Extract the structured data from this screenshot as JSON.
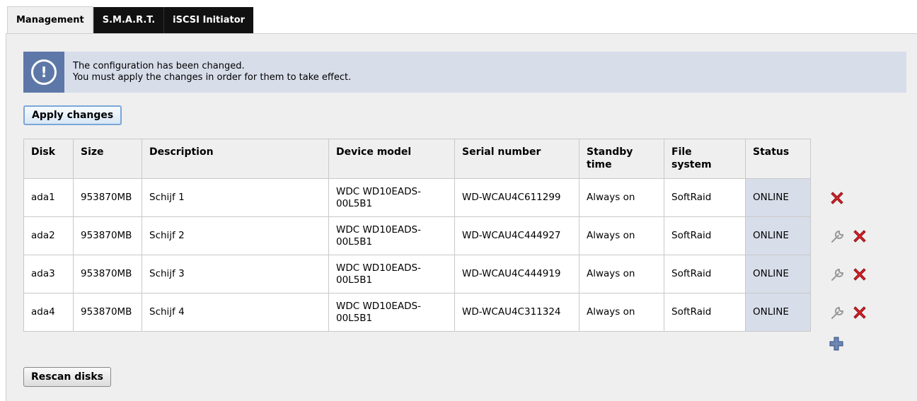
{
  "tabs": [
    {
      "label": "Management",
      "active": true
    },
    {
      "label": "S.M.A.R.T.",
      "active": false
    },
    {
      "label": "iSCSI Initiator",
      "active": false
    }
  ],
  "notice": {
    "line1": "The configuration has been changed.",
    "line2": "You must apply the changes in order for them to take effect."
  },
  "buttons": {
    "apply": "Apply changes",
    "rescan": "Rescan disks"
  },
  "table": {
    "headers": [
      "Disk",
      "Size",
      "Description",
      "Device model",
      "Serial number",
      "Standby time",
      "File system",
      "Status"
    ],
    "rows": [
      {
        "disk": "ada1",
        "size": "953870MB",
        "description": "Schijf 1",
        "model": "WDC WD10EADS-00L5B1",
        "serial": "WD-WCAU4C611299",
        "standby": "Always on",
        "fs": "SoftRaid",
        "status": "ONLINE"
      },
      {
        "disk": "ada2",
        "size": "953870MB",
        "description": "Schijf 2",
        "model": "WDC WD10EADS-00L5B1",
        "serial": "WD-WCAU4C444927",
        "standby": "Always on",
        "fs": "SoftRaid",
        "status": "ONLINE"
      },
      {
        "disk": "ada3",
        "size": "953870MB",
        "description": "Schijf 3",
        "model": "WDC WD10EADS-00L5B1",
        "serial": "WD-WCAU4C444919",
        "standby": "Always on",
        "fs": "SoftRaid",
        "status": "ONLINE"
      },
      {
        "disk": "ada4",
        "size": "953870MB",
        "description": "Schijf 4",
        "model": "WDC WD10EADS-00L5B1",
        "serial": "WD-WCAU4C311324",
        "standby": "Always on",
        "fs": "SoftRaid",
        "status": "ONLINE"
      }
    ]
  },
  "row_actions": [
    [
      "delete-icon"
    ],
    [
      "wrench-icon",
      "delete-icon"
    ],
    [
      "wrench-icon",
      "delete-icon"
    ],
    [
      "wrench-icon",
      "delete-icon"
    ]
  ],
  "add_action": "add-icon",
  "colors": {
    "tab_inactive_bg": "#111111",
    "notice_bg": "#d7dde9",
    "notice_icon_bg": "#5d78a8",
    "status_cell_bg": "#d7dde9",
    "delete_red": "#d8232a",
    "add_blue": "#3a5a8c"
  }
}
